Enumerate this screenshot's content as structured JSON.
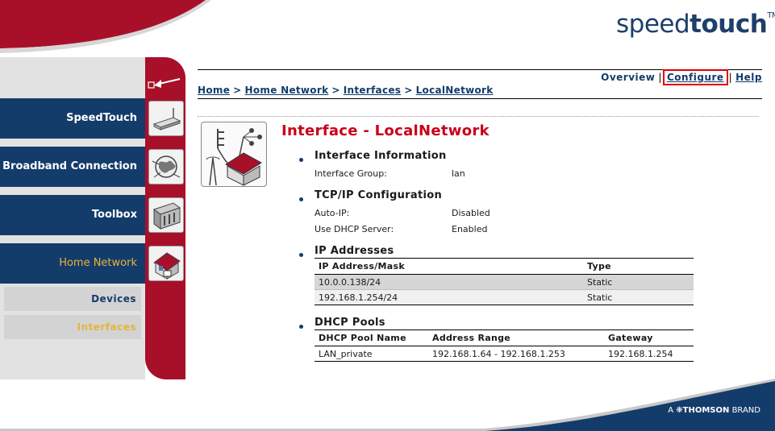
{
  "brand": {
    "logo_light": "speed",
    "logo_bold": "touch",
    "trademark": "TM",
    "footer_prefix": "A",
    "footer_brand": "THOMSON",
    "footer_suffix": "BRAND"
  },
  "top_links": [
    {
      "label": "Overview",
      "active": false
    },
    {
      "label": "Configure",
      "active": true
    },
    {
      "label": "Help",
      "active": false
    }
  ],
  "breadcrumb": [
    "Home",
    "Home Network",
    "Interfaces",
    "LocalNetwork"
  ],
  "nav": [
    {
      "label": "SpeedTouch",
      "icon": "router-icon",
      "active": false
    },
    {
      "label": "Broadband Connection",
      "icon": "globe-icon",
      "active": false
    },
    {
      "label": "Toolbox",
      "icon": "toolbox-icon",
      "active": false
    },
    {
      "label": "Home Network",
      "icon": "house-icon",
      "active": true
    }
  ],
  "subnav": [
    {
      "label": "Devices",
      "active": false
    },
    {
      "label": "Interfaces",
      "active": true
    }
  ],
  "page": {
    "title": "Interface - LocalNetwork",
    "interface_info": {
      "heading": "Interface Information",
      "rows": [
        {
          "label": "Interface Group:",
          "value": "lan"
        }
      ]
    },
    "tcpip": {
      "heading": "TCP/IP Configuration",
      "rows": [
        {
          "label": "Auto-IP:",
          "value": "Disabled"
        },
        {
          "label": "Use DHCP Server:",
          "value": "Enabled"
        }
      ]
    },
    "ip_addresses": {
      "heading": "IP Addresses",
      "columns": [
        "IP Address/Mask",
        "Type"
      ],
      "rows": [
        [
          "10.0.0.138/24",
          "Static"
        ],
        [
          "192.168.1.254/24",
          "Static"
        ]
      ]
    },
    "dhcp_pools": {
      "heading": "DHCP Pools",
      "columns": [
        "DHCP Pool Name",
        "Address Range",
        "Gateway"
      ],
      "rows": [
        [
          "LAN_private",
          "192.168.1.64 - 192.168.1.253",
          "192.168.1.254"
        ]
      ]
    }
  },
  "colors": {
    "navy": "#143c6b",
    "red": "#a8102a",
    "title_red": "#c8001a",
    "highlight_box": "#e00000",
    "active_nav_text": "#e6b43c"
  }
}
